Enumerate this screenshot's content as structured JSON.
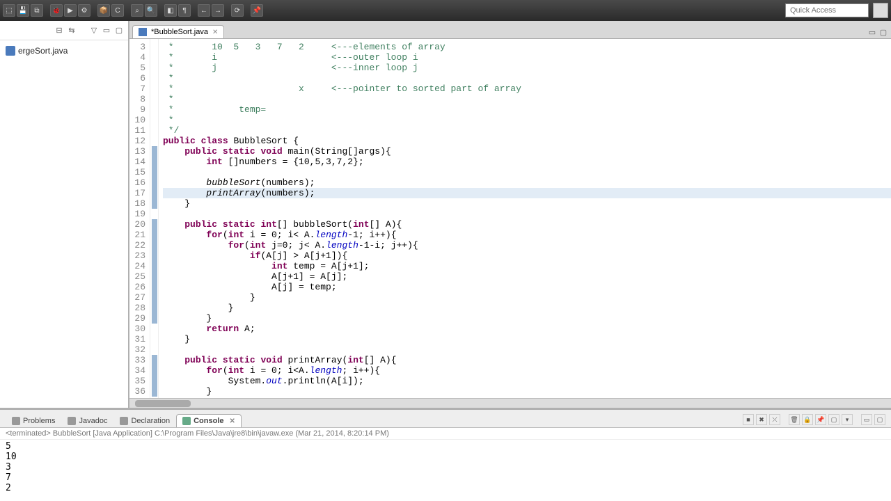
{
  "quick_access": {
    "placeholder": "Quick Access"
  },
  "sidebar": {
    "files": [
      {
        "name": "ergeSort.java"
      }
    ]
  },
  "editor": {
    "tab": {
      "label": "*BubbleSort.java"
    },
    "lines": [
      {
        "n": 3,
        "cls": "cm",
        "t": " *       10  5   3   7   2     <---elements of array"
      },
      {
        "n": 4,
        "cls": "cm",
        "t": " *       i                     <---outer loop i"
      },
      {
        "n": 5,
        "cls": "cm",
        "t": " *       j                     <---inner loop j"
      },
      {
        "n": 6,
        "cls": "cm",
        "t": " *"
      },
      {
        "n": 7,
        "cls": "cm",
        "t": " *                       x     <---pointer to sorted part of array"
      },
      {
        "n": 8,
        "cls": "cm",
        "t": " *"
      },
      {
        "n": 9,
        "cls": "cm",
        "t": " *            temp="
      },
      {
        "n": 10,
        "cls": "cm",
        "t": " *"
      },
      {
        "n": 11,
        "cls": "cm",
        "t": " */"
      },
      {
        "n": 12,
        "html": "<span class='kw'>public</span> <span class='kw'>class</span> BubbleSort {"
      },
      {
        "n": 13,
        "fold": true,
        "html": "    <span class='kw'>public</span> <span class='kw'>static</span> <span class='kw'>void</span> main(String[]args){"
      },
      {
        "n": 14,
        "fold": true,
        "html": "        <span class='kw'>int</span> []numbers = {10,5,3,7,2};"
      },
      {
        "n": 15,
        "fold": true,
        "t": ""
      },
      {
        "n": 16,
        "fold": true,
        "html": "        <span class='mth-italic'>bubbleSort</span>(numbers);"
      },
      {
        "n": 17,
        "fold": true,
        "hl": true,
        "html": "        <span class='mth-italic'>printArray</span>(numbers);"
      },
      {
        "n": 18,
        "fold": true,
        "t": "    }"
      },
      {
        "n": 19,
        "t": ""
      },
      {
        "n": 20,
        "fold": true,
        "html": "    <span class='kw'>public</span> <span class='kw'>static</span> <span class='kw'>int</span>[] bubbleSort(<span class='kw'>int</span>[] A){"
      },
      {
        "n": 21,
        "fold": true,
        "html": "        <span class='kw'>for</span>(<span class='kw'>int</span> i = 0; i&lt; A.<span class='fld'>length</span>-1; i++){"
      },
      {
        "n": 22,
        "fold": true,
        "html": "            <span class='kw'>for</span>(<span class='kw'>int</span> j=0; j&lt; A.<span class='fld'>length</span>-1-i; j++){"
      },
      {
        "n": 23,
        "fold": true,
        "html": "                <span class='kw'>if</span>(A[j] &gt; A[j+1]){"
      },
      {
        "n": 24,
        "fold": true,
        "html": "                    <span class='kw'>int</span> temp = A[j+1];"
      },
      {
        "n": 25,
        "fold": true,
        "t": "                    A[j+1] = A[j];"
      },
      {
        "n": 26,
        "fold": true,
        "t": "                    A[j] = temp;"
      },
      {
        "n": 27,
        "fold": true,
        "t": "                }"
      },
      {
        "n": 28,
        "fold": true,
        "t": "            }"
      },
      {
        "n": 29,
        "fold": true,
        "t": "        }"
      },
      {
        "n": 30,
        "html": "        <span class='kw'>return</span> A;"
      },
      {
        "n": 31,
        "t": "    }"
      },
      {
        "n": 32,
        "t": ""
      },
      {
        "n": 33,
        "fold": true,
        "html": "    <span class='kw'>public</span> <span class='kw'>static</span> <span class='kw'>void</span> printArray(<span class='kw'>int</span>[] A){"
      },
      {
        "n": 34,
        "fold": true,
        "html": "        <span class='kw'>for</span>(<span class='kw'>int</span> i = 0; i&lt;A.<span class='fld'>length</span>; i++){"
      },
      {
        "n": 35,
        "fold": true,
        "html": "            System.<span class='fld'>out</span>.println(A[i]);"
      },
      {
        "n": 36,
        "fold": true,
        "t": "        }"
      }
    ]
  },
  "bottom": {
    "tabs": {
      "problems": "Problems",
      "javadoc": "Javadoc",
      "declaration": "Declaration",
      "console": "Console"
    },
    "status": "<terminated> BubbleSort [Java Application] C:\\Program Files\\Java\\jre8\\bin\\javaw.exe (Mar 21, 2014, 8:20:14 PM)",
    "output": "5\n10\n3\n7\n2"
  }
}
